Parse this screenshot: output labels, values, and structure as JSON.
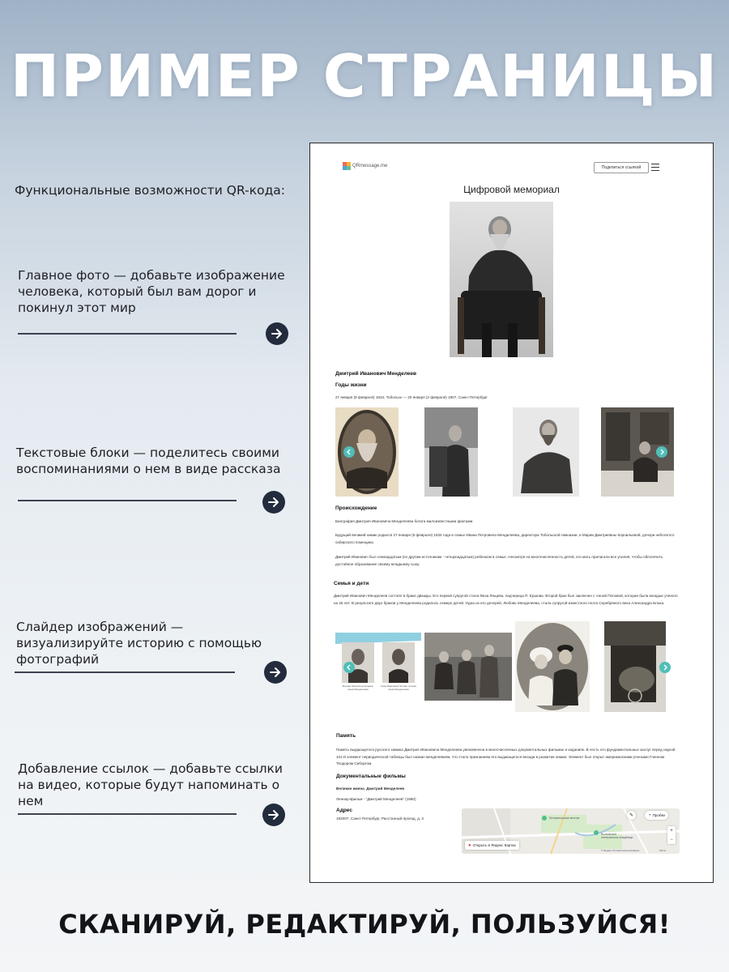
{
  "heading": "ПРИМЕР СТРАНИЦЫ",
  "features_intro": "Функциональные возможности QR-кода:",
  "features": [
    {
      "text": "Главное фото — добавьте изображение человека, который был вам дорог и покинул этот мир"
    },
    {
      "text": "Текстовые блоки — поделитесь своими воспоминаниями о нем в виде рассказа"
    },
    {
      "text": "Слайдер изображений — визуализируйте историю с помощью фотографий"
    },
    {
      "text": "Добавление ссылок — добавьте ссылки на видео, которые будут напоминать о нем"
    }
  ],
  "slogan": "СКАНИРУЙ, РЕДАКТИРУЙ, ПОЛЬЗУЙСЯ!",
  "page_mock": {
    "logo": "QRmessage.me",
    "share_button": "Поделиться ссылкой",
    "title": "Цифровой мемориал",
    "person_name": "Дмитрий Иванович Менделеев",
    "years_heading": "Годы жизни",
    "years_text": "27 января (8 февраля) 1834, Тобольск — 20 января (2 февраля) 1907, Санкт-Петербург",
    "origin_heading": "Происхождение",
    "origin_p1": "Биография Дмитрия Ивановича Менделеева богата малоизвестными фактами.",
    "origin_p2": "Будущий великий химик родился 27 января (8 февраля) 1834 года в семье Ивана Петровича Менделеева, директора Тобольской гимназии, и Марии Дмитриевны Корнильевой, дочери небогатого сибирского помещика.",
    "origin_p3": "Дмитрий Иванович был семнадцатым (по другим источникам - четырнадцатым) ребенком в семье. Несмотря на многочисленность детей, его мать прилагала все усилия, чтобы обеспечить достойное образование своему младшему сыну.",
    "family_heading": "Семья и дети",
    "family_text": "Дмитрий Иванович Менделеев состоял в браке дважды. Его первой супругой стала Физа Лещева, падчерица П. Ершова. Второй брак был заключен с Анной Поповой, которая была младше ученого на 26 лет. В результате двух браков у Менделеева родилось семеро детей. Одна из его дочерей, Любовь Менделеева, стала супругой известного поэта Серебряного века Александра Блока.",
    "caption_1": "Феозва Никитична Лещева, жена Менделеева",
    "caption_2": "Анна Ивановна Попова, вторая жена Менделеева",
    "memory_heading": "Память",
    "memory_text": "Память выдающегося русского химика Дмитрия Ивановича Менделеева увековечена в многочисленных документальных фильмах и изданиях. В честь его фундаментальных заслуг перед наукой 101-й элемент периодической таблицы был назван менделевием, что стало признанием его выдающегося вклада в развитие химии. Элемент был открыт американскими учеными Гленном Теодором Сиборгом.",
    "films_heading": "Документальные фильмы",
    "film_1": "Великие имена. Дмитрий Менделеев",
    "film_2": "Леннаучфильм - \"Дмитрий Менделеев\" (1980)",
    "address_heading": "Адрес",
    "address_text": "192007, Санкт-Петербург, Расстанный проезд, д. 3.",
    "map_open": "Открыть в Яндекс Картах",
    "map_traffic": "Пробки",
    "map_label_1": "Литераторские мостки",
    "map_label_2": "Волковское лютеранское кладбище",
    "map_footer": "© Яндекс  Условия использования",
    "map_scale": "100 м"
  },
  "colors": {
    "arrow_button": "#222c3d",
    "slider_button": "#4fbfb8",
    "heading": "#ffffff"
  }
}
